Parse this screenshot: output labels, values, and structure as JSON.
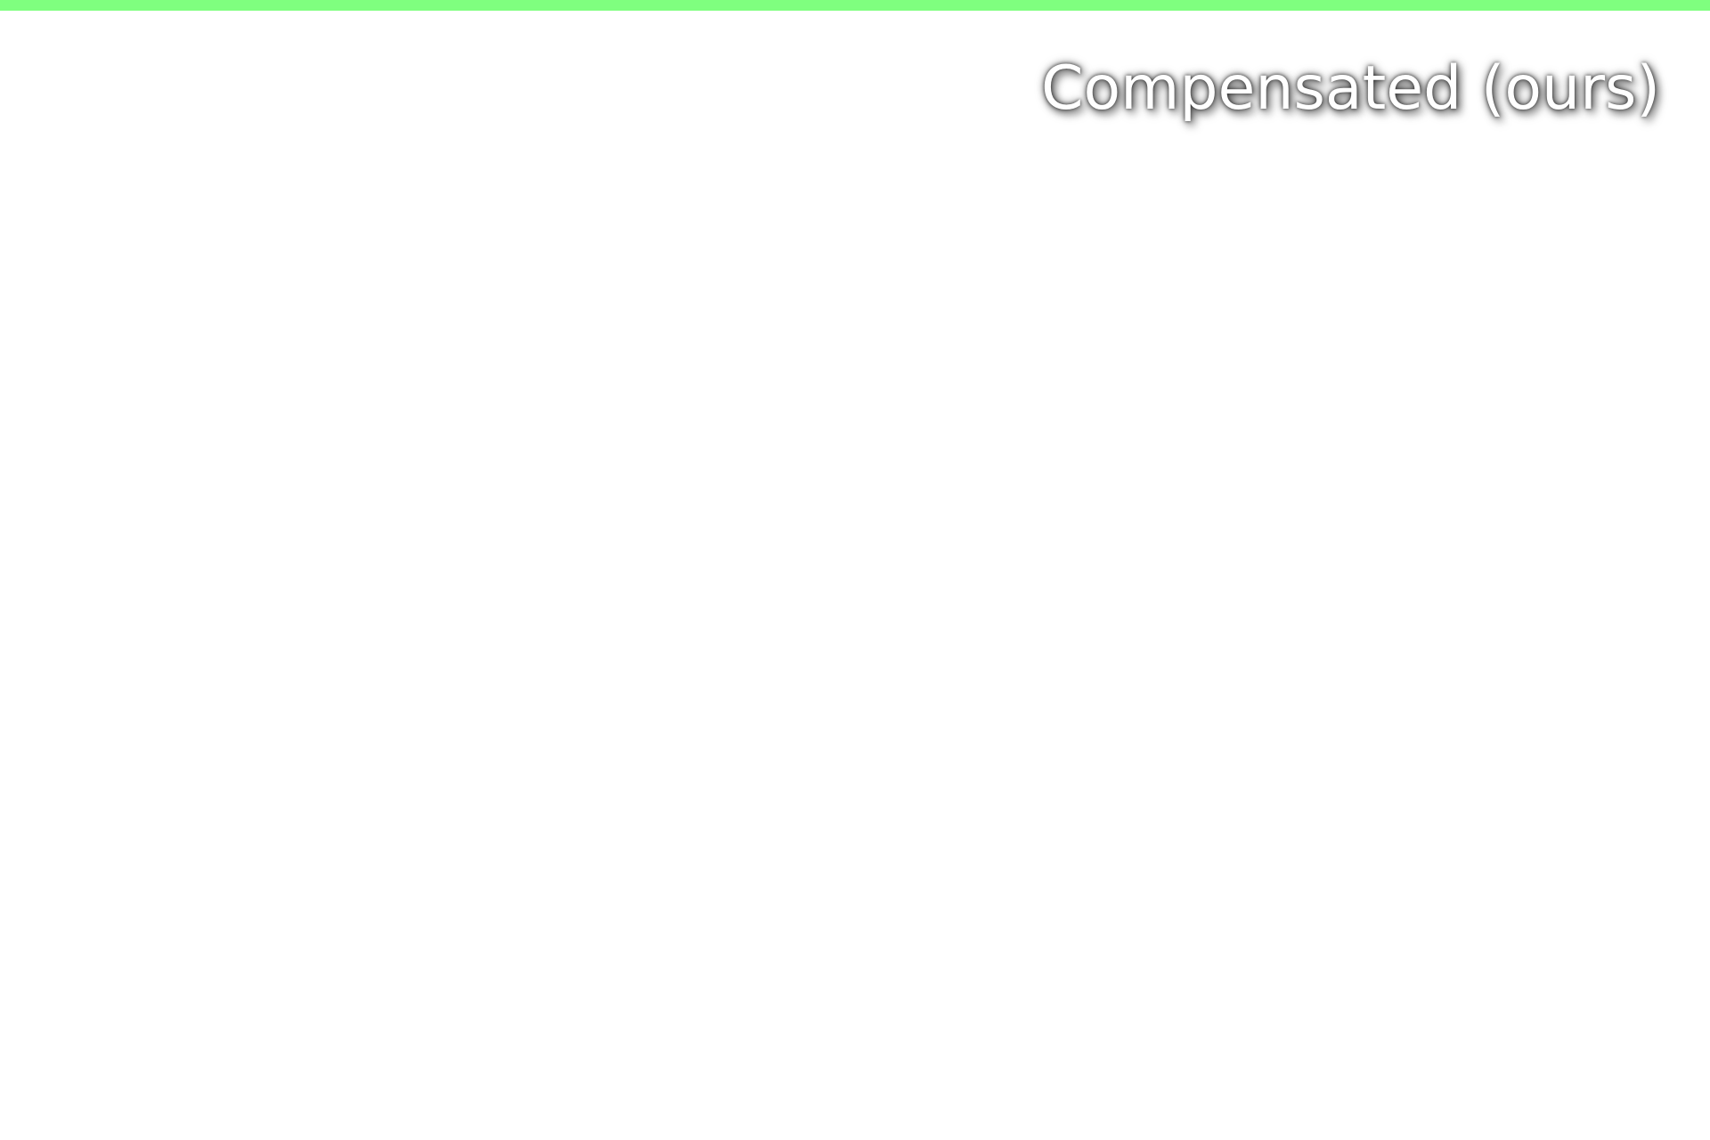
{
  "label": {
    "text": "Compensated (ours)"
  },
  "colors": {
    "top_bar": "#7fff7f",
    "background": "#ffffff",
    "label_text": "#ffffff"
  }
}
